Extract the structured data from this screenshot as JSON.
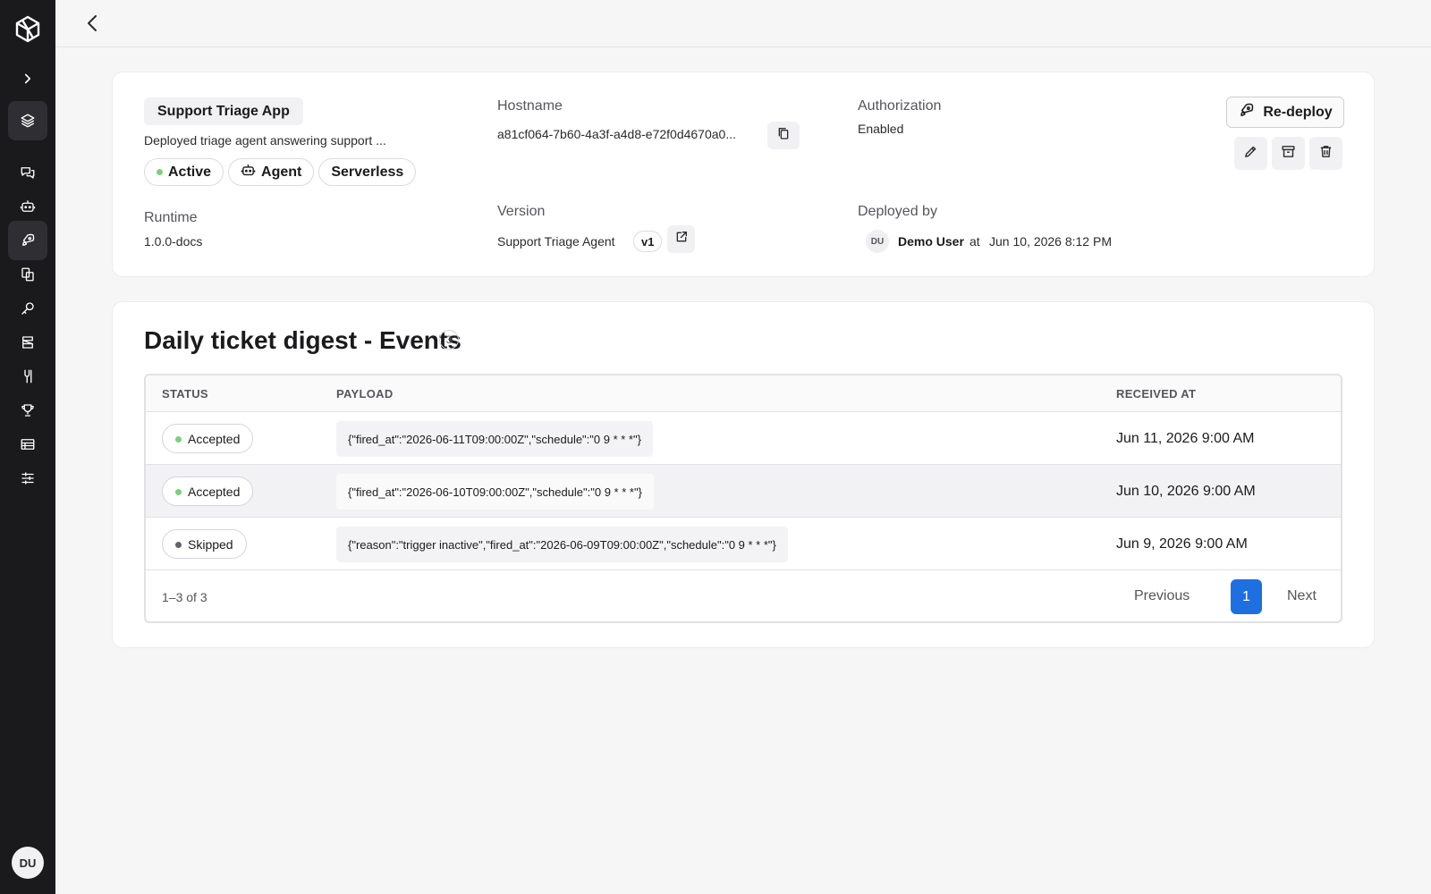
{
  "sidebar": {
    "logo_icon": "unity-cube-logo",
    "items": [
      {
        "name": "expand-sidebar-icon"
      },
      {
        "name": "layers-icon"
      },
      {
        "name": "chat-icon"
      },
      {
        "name": "bot-icon"
      },
      {
        "name": "rocket-icon"
      },
      {
        "name": "documents-icon"
      },
      {
        "name": "key-icon"
      },
      {
        "name": "database-icon"
      },
      {
        "name": "tools-icon"
      },
      {
        "name": "trophy-icon"
      },
      {
        "name": "table-icon"
      },
      {
        "name": "settings-sliders-icon"
      }
    ],
    "avatar_initials": "DU"
  },
  "app": {
    "name": "Support Triage App",
    "description": "Deployed triage agent answering support ...",
    "badges": {
      "status": "Active",
      "type": "Agent",
      "mode": "Serverless"
    },
    "hostname_label": "Hostname",
    "hostname": "a81cf064-7b60-4a3f-a4d8-e72f0d4670a0...",
    "authorization_label": "Authorization",
    "authorization": "Enabled",
    "runtime_label": "Runtime",
    "runtime": "1.0.0-docs",
    "version_label": "Version",
    "version_name": "Support Triage Agent",
    "version_tag": "v1",
    "deployed_by_label": "Deployed by",
    "deployed_by_initials": "DU",
    "deployed_by": "Demo User",
    "deployed_at_word": "at",
    "deployed_at": "Jun 10, 2026 8:12 PM",
    "redeploy_label": "Re-deploy"
  },
  "events": {
    "title": "Daily ticket digest - Events",
    "count": "3",
    "columns": {
      "status": "STATUS",
      "payload": "PAYLOAD",
      "received": "RECEIVED AT"
    },
    "rows": [
      {
        "status": "Accepted",
        "payload": "{\"fired_at\":\"2026-06-11T09:00:00Z\",\"schedule\":\"0 9 * * *\"}",
        "received": "Jun 11, 2026 9:00 AM"
      },
      {
        "status": "Accepted",
        "payload": "{\"fired_at\":\"2026-06-10T09:00:00Z\",\"schedule\":\"0 9 * * *\"}",
        "received": "Jun 10, 2026 9:00 AM"
      },
      {
        "status": "Skipped",
        "payload": "{\"reason\":\"trigger inactive\",\"fired_at\":\"2026-06-09T09:00:00Z\",\"schedule\":\"0 9 * * *\"}",
        "received": "Jun 9, 2026 9:00 AM"
      }
    ],
    "pagination": {
      "range": "1–3 of 3",
      "previous": "Previous",
      "current": "1",
      "next": "Next"
    }
  },
  "colors": {
    "accent": "#1e6fe0",
    "accepted": "#7dd07a",
    "skipped": "#5f6368",
    "sidebar": "#1a1a1c"
  }
}
